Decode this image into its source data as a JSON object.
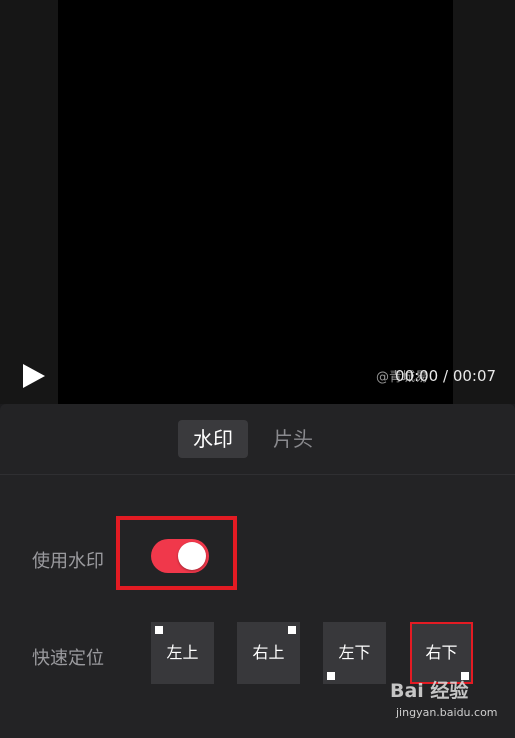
{
  "video": {
    "watermark_text": "@青城易",
    "time": "00:00 / 00:07"
  },
  "tabs": [
    {
      "label": "水印",
      "active": true
    },
    {
      "label": "片头",
      "active": false
    }
  ],
  "settings": {
    "use_watermark_label": "使用水印",
    "use_watermark_on": true,
    "position_label": "快速定位",
    "positions": [
      "左上",
      "右上",
      "左下",
      "右下"
    ],
    "selected_position": "右下"
  },
  "overlay_logo": {
    "text": "Bai 经验",
    "url": "jingyan.baidu.com"
  },
  "colors": {
    "accent": "#f0384b",
    "highlight": "#e31b23",
    "panel": "#232325"
  }
}
